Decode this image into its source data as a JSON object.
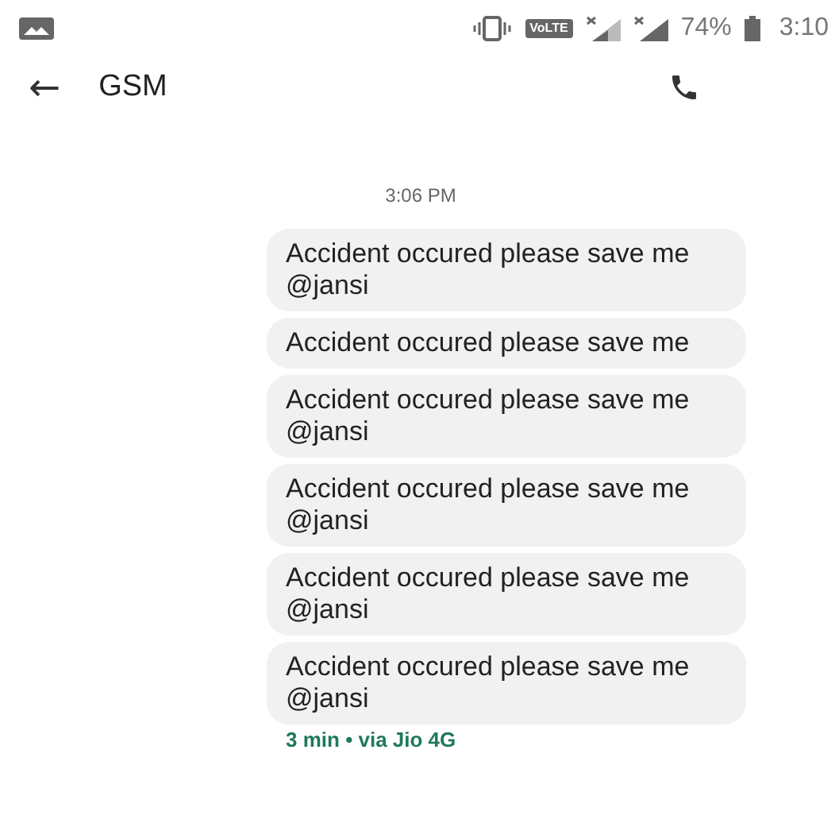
{
  "status_bar": {
    "volte": "VoLTE",
    "battery": "74%",
    "time": "3:10"
  },
  "toolbar": {
    "back": "←",
    "title": "GSM"
  },
  "date_divider": "3:06 PM",
  "messages": [
    {
      "text": "Accident occured please save me @jansi"
    },
    {
      "text": "Accident occured please save me"
    },
    {
      "text": "Accident occured please save me @jansi"
    },
    {
      "text": "Accident occured please save me @jansi"
    },
    {
      "text": "Accident occured please save me @jansi"
    },
    {
      "text": "Accident occured please save me @jansi"
    }
  ],
  "footer": {
    "age": "3 min",
    "separator": "•",
    "network": "via Jio 4G"
  }
}
